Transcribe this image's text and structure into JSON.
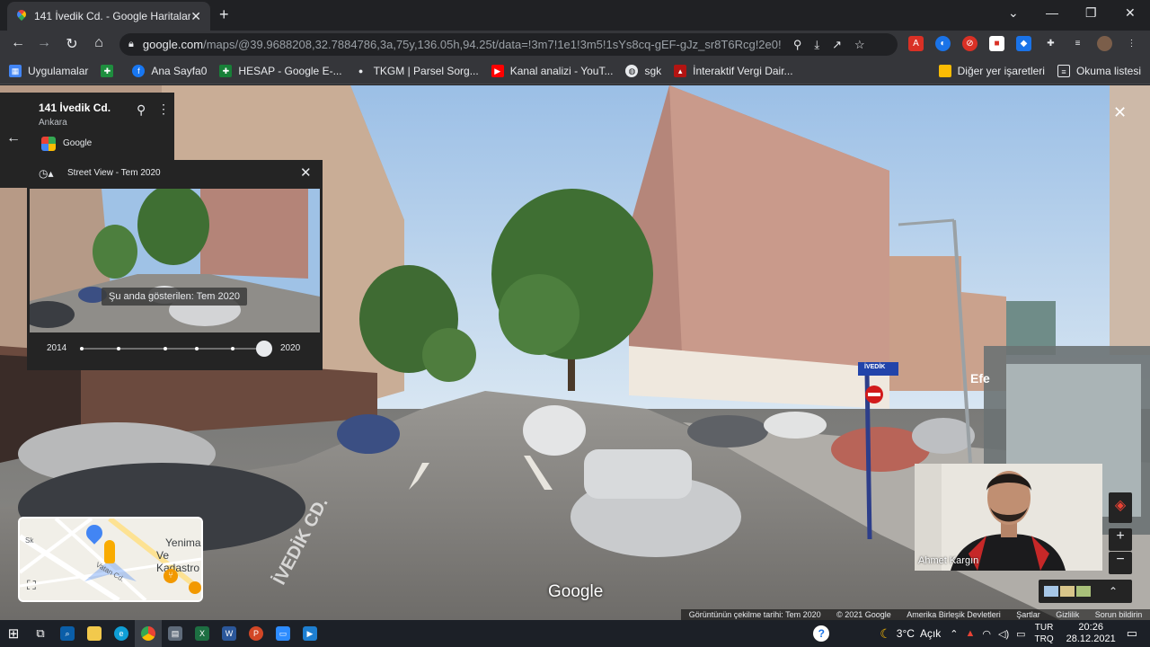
{
  "browser": {
    "tab_title": "141 İvedik Cd. - Google Haritalar",
    "url_domain": "google.com",
    "url_path": "/maps/@39.9688208,32.7884786,3a,75y,136.05h,94.25t/data=!3m7!1e1!3m5!1sYs8cq-gEF-gJz_sr8T6Rcg!2e0!5..."
  },
  "bookmarks": [
    {
      "label": "Uygulamalar",
      "color": "#34a853"
    },
    {
      "label": "",
      "color": "#1e8e3e"
    },
    {
      "label": "Ana Sayfa0",
      "color": "#1877f2"
    },
    {
      "label": "HESAP - Google E-...",
      "color": "#188038"
    },
    {
      "label": "TKGM | Parsel Sorg...",
      "color": "#202124"
    },
    {
      "label": "Kanal analizi - YouT...",
      "color": "#ff0000"
    },
    {
      "label": "sgk",
      "color": "#5f6368"
    },
    {
      "label": "İnteraktif Vergi Dair...",
      "color": "#b31412"
    }
  ],
  "bookmarks_right": {
    "other": "Diğer yer işaretleri",
    "reading": "Okuma listesi"
  },
  "place": {
    "name": "141 İvedik Cd.",
    "city": "Ankara",
    "provider": "Google"
  },
  "streetview": {
    "header": "Street View - Tem 2020",
    "current": "Şu anda gösterilen: Tem 2020",
    "year_start": "2014",
    "year_end": "2020",
    "dots": [
      0,
      0.2,
      0.46,
      0.63,
      0.83,
      1
    ]
  },
  "minimap": {
    "label1": "Yenima",
    "label2": "Ve Kadastro",
    "street1": "Vatan Cd.",
    "street2": "Sk"
  },
  "camera": {
    "person_name": "Ahmet Kargın"
  },
  "scene": {
    "google_logo": "Google",
    "street_sign": "İVEDİK",
    "road_text": "İVEDİK CD.",
    "shop_sign": "Efe"
  },
  "footer": {
    "capture_date": "Görüntünün çekilme tarihi: Tem 2020",
    "copyright": "© 2021 Google",
    "country": "Amerika Birleşik Devletleri",
    "terms": "Şartlar",
    "privacy": "Gizlilik",
    "report": "Sorun bildirin"
  },
  "taskbar": {
    "weather": "3°C",
    "weather_desc": "Açık",
    "lang_top": "TUR",
    "lang_bottom": "TRQ",
    "time": "20:26",
    "date": "28.12.2021"
  }
}
